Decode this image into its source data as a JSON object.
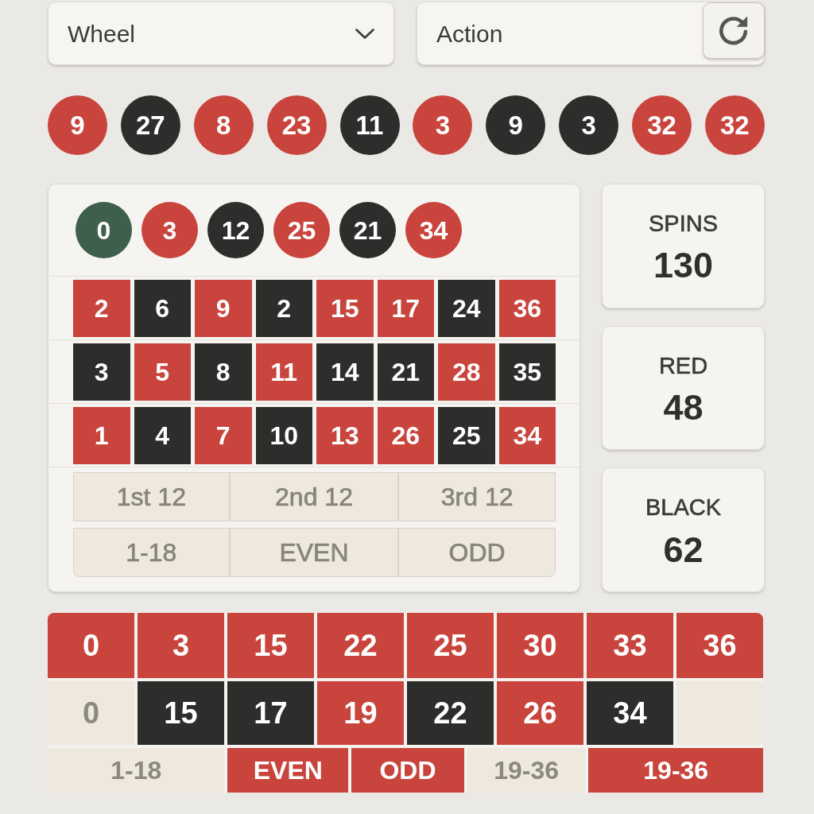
{
  "wheel_dropdown": {
    "value": "Wheel"
  },
  "action_field": {
    "value": "Action"
  },
  "recent_numbers": [
    {
      "number": "9",
      "color": "#c8443c"
    },
    {
      "number": "27",
      "color": "#2d2d2b"
    },
    {
      "number": "8",
      "color": "#c8443c"
    },
    {
      "number": "23",
      "color": "#c8443c"
    },
    {
      "number": "11",
      "color": "#2d2d2b"
    },
    {
      "number": "3",
      "color": "#c8443c"
    },
    {
      "number": "9",
      "color": "#2d2d2b"
    },
    {
      "number": "3",
      "color": "#2d2d2b"
    },
    {
      "number": "32",
      "color": "#c8443c"
    },
    {
      "number": "32",
      "color": "#c8443c"
    }
  ],
  "board": {
    "recent": [
      {
        "number": "0",
        "color": "#3e5f4c"
      },
      {
        "number": "3",
        "color": "#c8443c"
      },
      {
        "number": "12",
        "color": "#2d2d2b"
      },
      {
        "number": "25",
        "color": "#c8443c"
      },
      {
        "number": "21",
        "color": "#2d2d2b"
      },
      {
        "number": "34",
        "color": "#c8443c"
      }
    ],
    "grid": [
      [
        {
          "number": "2",
          "color": "#c8443c"
        },
        {
          "number": "6",
          "color": "#2d2d2b"
        },
        {
          "number": "9",
          "color": "#c8443c"
        },
        {
          "number": "2",
          "color": "#2d2d2b"
        },
        {
          "number": "15",
          "color": "#c8443c"
        },
        {
          "number": "17",
          "color": "#c8443c"
        },
        {
          "number": "24",
          "color": "#2d2d2b"
        },
        {
          "number": "36",
          "color": "#c8443c"
        }
      ],
      [
        {
          "number": "3",
          "color": "#2d2d2b"
        },
        {
          "number": "5",
          "color": "#c8443c"
        },
        {
          "number": "8",
          "color": "#2d2d2b"
        },
        {
          "number": "11",
          "color": "#c8443c"
        },
        {
          "number": "14",
          "color": "#2d2d2b"
        },
        {
          "number": "21",
          "color": "#2d2d2b"
        },
        {
          "number": "28",
          "color": "#c8443c"
        },
        {
          "number": "35",
          "color": "#2d2d2b"
        }
      ],
      [
        {
          "number": "1",
          "color": "#c8443c"
        },
        {
          "number": "4",
          "color": "#2d2d2b"
        },
        {
          "number": "7",
          "color": "#c8443c"
        },
        {
          "number": "10",
          "color": "#2d2d2b"
        },
        {
          "number": "13",
          "color": "#c8443c"
        },
        {
          "number": "26",
          "color": "#c8443c"
        },
        {
          "number": "25",
          "color": "#2d2d2b"
        },
        {
          "number": "34",
          "color": "#c8443c"
        }
      ]
    ],
    "dozens": [
      "1st 12",
      "2nd 12",
      "3rd 12"
    ],
    "outside_bets": [
      "1-18",
      "EVEN",
      "ODD"
    ]
  },
  "stats": [
    {
      "label": "SPINS",
      "value": "130"
    },
    {
      "label": "RED",
      "value": "48"
    },
    {
      "label": "BLACK",
      "value": "62"
    }
  ],
  "results_table": {
    "number_rows": [
      [
        {
          "number": "0",
          "color": "#c8443c"
        },
        {
          "number": "3",
          "color": "#c8443c"
        },
        {
          "number": "15",
          "color": "#c8443c"
        },
        {
          "number": "22",
          "color": "#c8443c"
        },
        {
          "number": "25",
          "color": "#c8443c"
        },
        {
          "number": "30",
          "color": "#c8443c"
        },
        {
          "number": "33",
          "color": "#c8443c"
        },
        {
          "number": "36",
          "color": "#c8443c"
        }
      ],
      [
        {
          "number": "0",
          "color": "#efe8df"
        },
        {
          "number": "15",
          "color": "#2d2d2b"
        },
        {
          "number": "17",
          "color": "#2d2d2b"
        },
        {
          "number": "19",
          "color": "#c8443c"
        },
        {
          "number": "22",
          "color": "#2d2d2b"
        },
        {
          "number": "26",
          "color": "#c8443c"
        },
        {
          "number": "34",
          "color": "#2d2d2b"
        },
        {
          "color": "#efe8df"
        }
      ]
    ],
    "bet_row": [
      {
        "label": "1-18",
        "color": "#efe8df"
      },
      {
        "label": "EVEN",
        "color": "#c8443c"
      },
      {
        "label": "ODD",
        "color": "#c8443c"
      },
      {
        "label": "19-36",
        "color": "#efe8df"
      },
      {
        "label": "19-36",
        "color": "#c8443c"
      }
    ]
  }
}
